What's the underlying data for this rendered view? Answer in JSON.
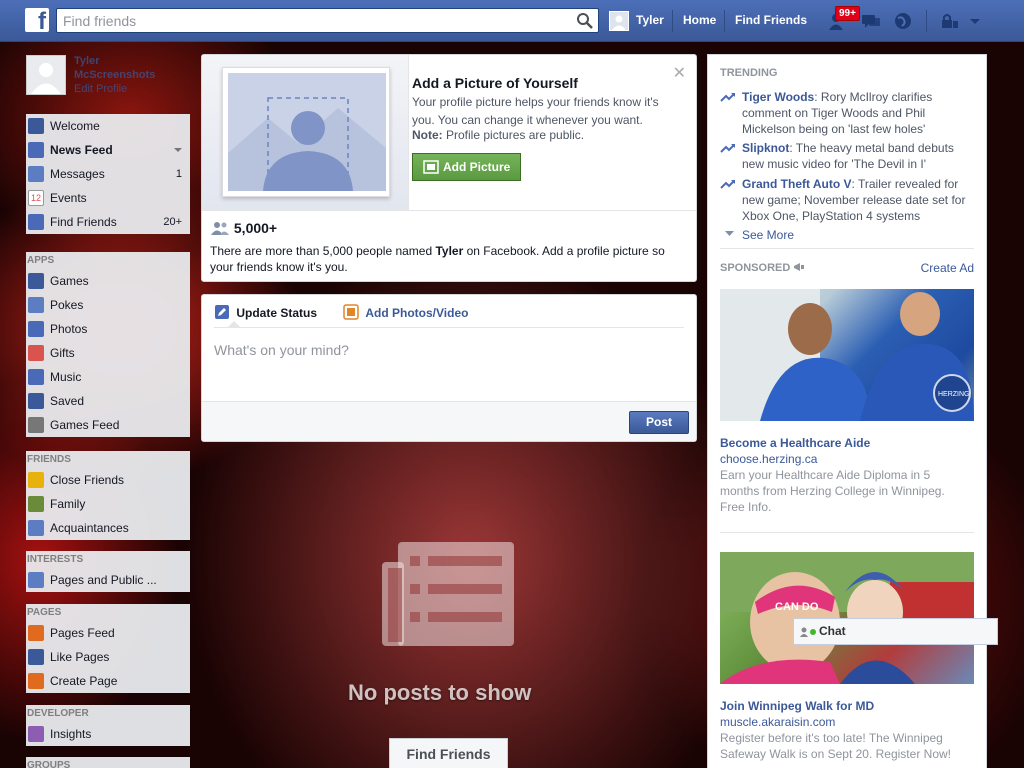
{
  "topbar": {
    "search_placeholder": "Find friends",
    "user_name": "Tyler",
    "home": "Home",
    "find_friends": "Find Friends",
    "notification_count": "99+"
  },
  "profile": {
    "name": "Tyler",
    "surname": "McScreenshots",
    "edit": "Edit Profile"
  },
  "sidebar": {
    "main": [
      {
        "label": "Welcome",
        "icon": "facebook-icon",
        "color": "#3b5998"
      },
      {
        "label": "News Feed",
        "icon": "news-feed-icon",
        "color": "#4a6ab8"
      },
      {
        "label": "Messages",
        "icon": "messages-icon",
        "count": "1",
        "color": "#5c7dc2"
      },
      {
        "label": "Events",
        "icon": "calendar-icon",
        "color": "#d9534f"
      },
      {
        "label": "Find Friends",
        "icon": "find-friends-icon",
        "count": "20+",
        "color": "#4a6ab8"
      }
    ],
    "apps_head": "APPS",
    "apps": [
      {
        "label": "Games",
        "icon": "games-icon",
        "color": "#3b5998"
      },
      {
        "label": "Pokes",
        "icon": "pokes-icon",
        "color": "#5c7dc2"
      },
      {
        "label": "Photos",
        "icon": "photos-icon",
        "color": "#4a6ab8"
      },
      {
        "label": "Gifts",
        "icon": "gift-icon",
        "color": "#d9534f"
      },
      {
        "label": "Music",
        "icon": "music-icon",
        "color": "#4a6ab8"
      },
      {
        "label": "Saved",
        "icon": "saved-icon",
        "color": "#3b5998"
      },
      {
        "label": "Games Feed",
        "icon": "controller-icon",
        "color": "#777777"
      }
    ],
    "friends_head": "FRIENDS",
    "friends": [
      {
        "label": "Close Friends",
        "icon": "star-icon",
        "color": "#e8b20e"
      },
      {
        "label": "Family",
        "icon": "house-icon",
        "color": "#6a8c3a"
      },
      {
        "label": "Acquaintances",
        "icon": "acquaintances-icon",
        "color": "#5c7dc2"
      }
    ],
    "interests_head": "INTERESTS",
    "interests": [
      {
        "label": "Pages and Public ...",
        "icon": "rss-icon",
        "color": "#5c7dc2"
      }
    ],
    "pages_head": "PAGES",
    "pages": [
      {
        "label": "Pages Feed",
        "icon": "flag-icon",
        "color": "#e06b1f"
      },
      {
        "label": "Like Pages",
        "icon": "thumbs-up-icon",
        "color": "#3b5998"
      },
      {
        "label": "Create Page",
        "icon": "plus-icon",
        "color": "#e06b1f"
      }
    ],
    "developer_head": "DEVELOPER",
    "developer": [
      {
        "label": "Insights",
        "icon": "chart-icon",
        "color": "#8c5db0"
      }
    ],
    "groups_head": "GROUPS"
  },
  "add_picture": {
    "title": "Add a Picture of Yourself",
    "text": "Your profile picture helps your friends know it's you. You can change it whenever you want.",
    "note_label": "Note:",
    "note_text": " Profile pictures are public.",
    "button": "Add Picture",
    "count": "5,000+",
    "desc_pre": "There are more than 5,000 people named ",
    "desc_name": "Tyler",
    "desc_post": " on Facebook. Add a profile picture so your friends know it's you."
  },
  "composer": {
    "tab_status": "Update Status",
    "tab_photos": "Add Photos/Video",
    "placeholder": "What's on your mind?",
    "post": "Post"
  },
  "feed": {
    "empty_text": "No posts to show",
    "find_friends": "Find Friends"
  },
  "trending": {
    "head": "TRENDING",
    "items": [
      {
        "topic": "Tiger Woods",
        "text": ": Rory McIlroy clarifies comment on Tiger Woods and Phil Mickelson being on 'last few holes'"
      },
      {
        "topic": "Slipknot",
        "text": ": The heavy metal band debuts new music video for 'The Devil in I'"
      },
      {
        "topic": "Grand Theft Auto V",
        "text": ": Trailer revealed for new game; November release date set for Xbox One, PlayStation 4 systems"
      }
    ],
    "see_more": "See More"
  },
  "sponsored": {
    "head": "SPONSORED",
    "create_ad": "Create Ad",
    "ads": [
      {
        "title": "Become a Healthcare Aide",
        "url": "choose.herzing.ca",
        "text": "Earn your Healthcare Aide Diploma in 5 months from Herzing College in Winnipeg. Free Info.",
        "badge": "HERZING"
      },
      {
        "title": "Join Winnipeg Walk for MD",
        "url": "muscle.akaraisin.com",
        "text": "Register before it's too late! The Winnipeg Safeway Walk is on Sept 20. Register Now!",
        "badge": "CAN DO"
      }
    ]
  },
  "chat": {
    "label": "Chat"
  }
}
